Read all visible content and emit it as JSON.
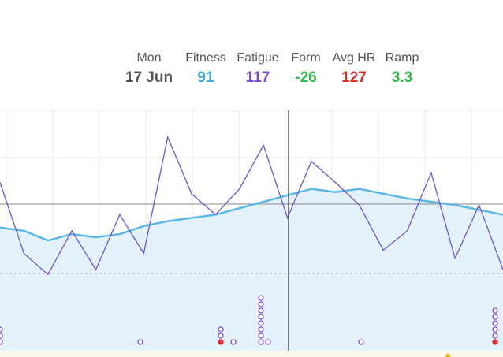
{
  "header": {
    "stats": [
      {
        "label": "Mon",
        "value": "17 Jun",
        "color": "#555555"
      },
      {
        "label": "Fitness",
        "value": "91",
        "color": "#3aa8e0"
      },
      {
        "label": "Fatigue",
        "value": "117",
        "color": "#7a4fcf"
      },
      {
        "label": "Form",
        "value": "-26",
        "color": "#2db84a"
      },
      {
        "label": "Avg HR",
        "value": "127",
        "color": "#d6322b"
      },
      {
        "label": "Ramp",
        "value": "3.3",
        "color": "#2db84a"
      }
    ]
  },
  "chart_data": {
    "type": "line",
    "series": [
      {
        "color": "#5bb7e6",
        "values": [
          64,
          62,
          56,
          60,
          58,
          60,
          65,
          68,
          70,
          72,
          76,
          80,
          84,
          88,
          86,
          88,
          85,
          82,
          80,
          78,
          75,
          72
        ]
      },
      {
        "color": "#7a5ccc",
        "values": [
          92,
          48,
          35,
          62,
          38,
          72,
          48,
          120,
          85,
          72,
          88,
          115,
          70,
          105,
          92,
          78,
          50,
          62,
          98,
          45,
          78,
          38
        ]
      }
    ],
    "colors": {
      "fitness_fill": "#e3f2fb",
      "grid": "#e5e5e5",
      "cursor": "#333333",
      "dot": "#7a4fcf",
      "dot_red": "#e0303a",
      "marker": "#f0b400"
    }
  }
}
